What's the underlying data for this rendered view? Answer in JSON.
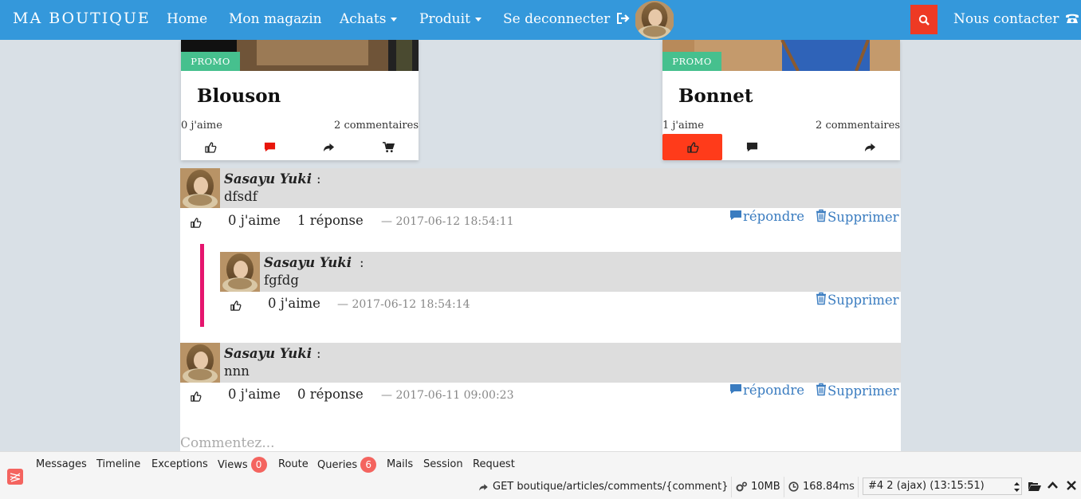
{
  "navbar": {
    "brand": "MA BOUTIQUE",
    "items": [
      "Home",
      "Mon magazin",
      "Achats",
      "Produit",
      "Se deconnecter"
    ],
    "contact": "Nous contacter"
  },
  "cards": [
    {
      "badge": "PROMO",
      "title": "Blouson",
      "likes": "0 j'aime",
      "comments": "2 commentaires"
    },
    {
      "badge": "PROMO",
      "title": "Bonnet",
      "likes": "1 j'aime",
      "comments": "2 commentaires"
    }
  ],
  "comments": [
    {
      "author": "Sasayu  Yuki",
      "colon": ":",
      "text": "dfsdf",
      "likes": "0 j'aime",
      "replies": "1 réponse",
      "date": "— 2017-06-12 18:54:11",
      "reply_label": "répondre",
      "delete_label": "Supprimer"
    },
    {
      "author": "Sasayu  Yuki",
      "colon": ":",
      "text": "fgfdg",
      "likes": "0 j'aime",
      "date": "— 2017-06-12 18:54:14",
      "delete_label": "Supprimer"
    },
    {
      "author": "Sasayu  Yuki",
      "colon": ":",
      "text": "nnn",
      "likes": "0 j'aime",
      "replies": "0 réponse",
      "date": "— 2017-06-11 09:00:23",
      "reply_label": "répondre",
      "delete_label": "Supprimer"
    }
  ],
  "comment_input": {
    "placeholder": "Commentez..."
  },
  "debugbar": {
    "tabs": [
      "Messages",
      "Timeline",
      "Exceptions",
      "Views",
      "Route",
      "Queries",
      "Mails",
      "Session",
      "Request"
    ],
    "views_count": "0",
    "queries_count": "6",
    "route": "GET boutique/articles/comments/{comment}",
    "memory": "10MB",
    "time": "168.84ms",
    "request_select": "#4 2 (ajax) (13:15:51)"
  },
  "colors": {
    "navbar": "#3498db",
    "promo": "#46c08e",
    "like_active": "#ff3b1a",
    "comment_icon": "#e8150a",
    "reply_bar": "#e5156e",
    "link": "#3a7cc0",
    "badge": "#f4645f"
  }
}
